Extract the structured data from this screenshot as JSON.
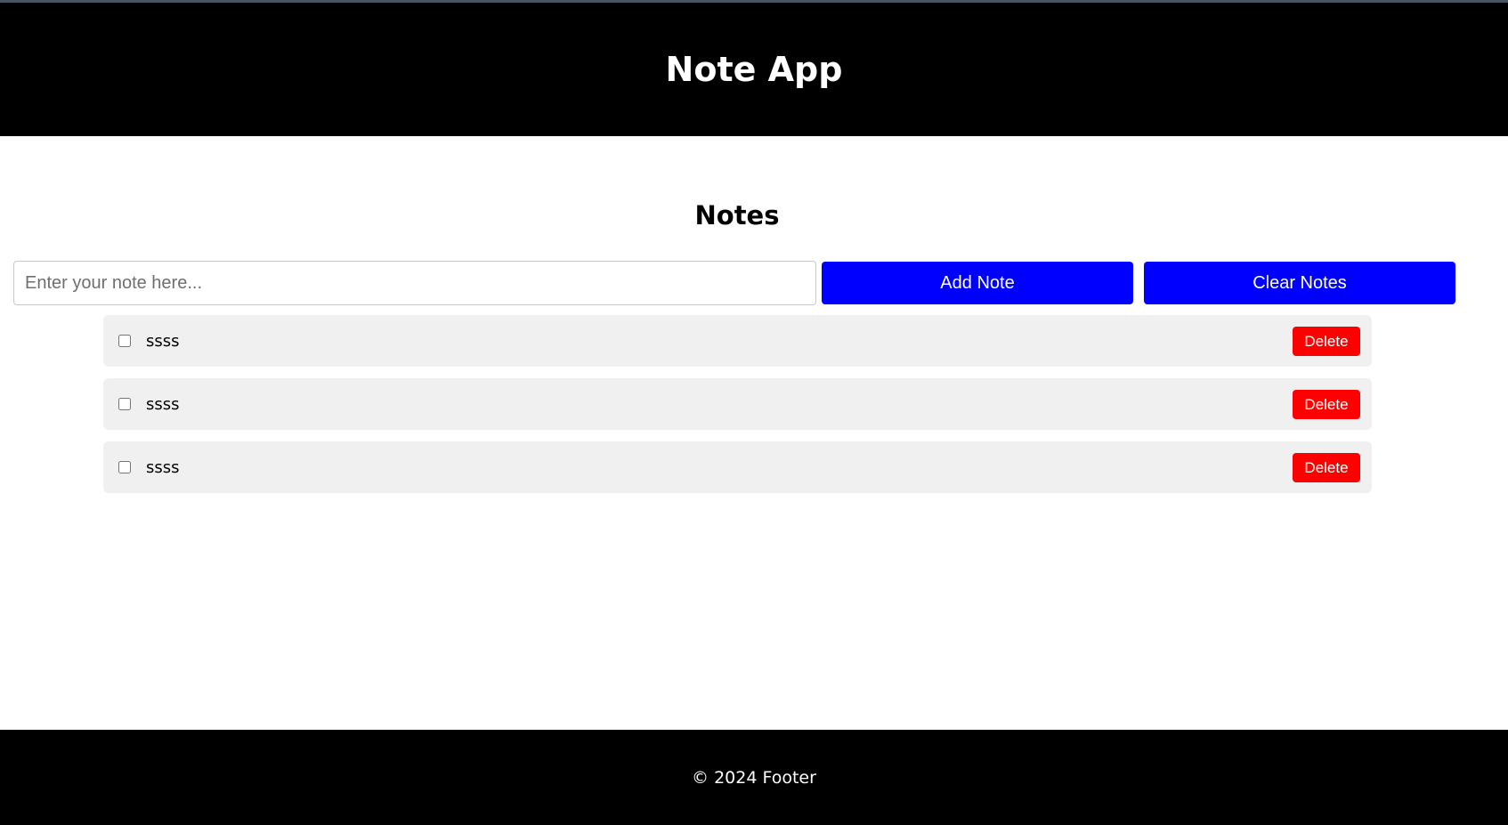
{
  "header": {
    "title": "Note App",
    "background": "#000000"
  },
  "main": {
    "section_title": "Notes",
    "input": {
      "placeholder": "Enter your note here...",
      "value": ""
    },
    "add_label": "Add Note",
    "clear_label": "Clear Notes",
    "accent": "#0000ff",
    "danger": "#ff0000",
    "notes": [
      {
        "text": "ssss",
        "checked": false,
        "delete_label": "Delete"
      },
      {
        "text": "ssss",
        "checked": false,
        "delete_label": "Delete"
      },
      {
        "text": "ssss",
        "checked": false,
        "delete_label": "Delete"
      }
    ]
  },
  "footer": {
    "text": "© 2024 Footer"
  }
}
